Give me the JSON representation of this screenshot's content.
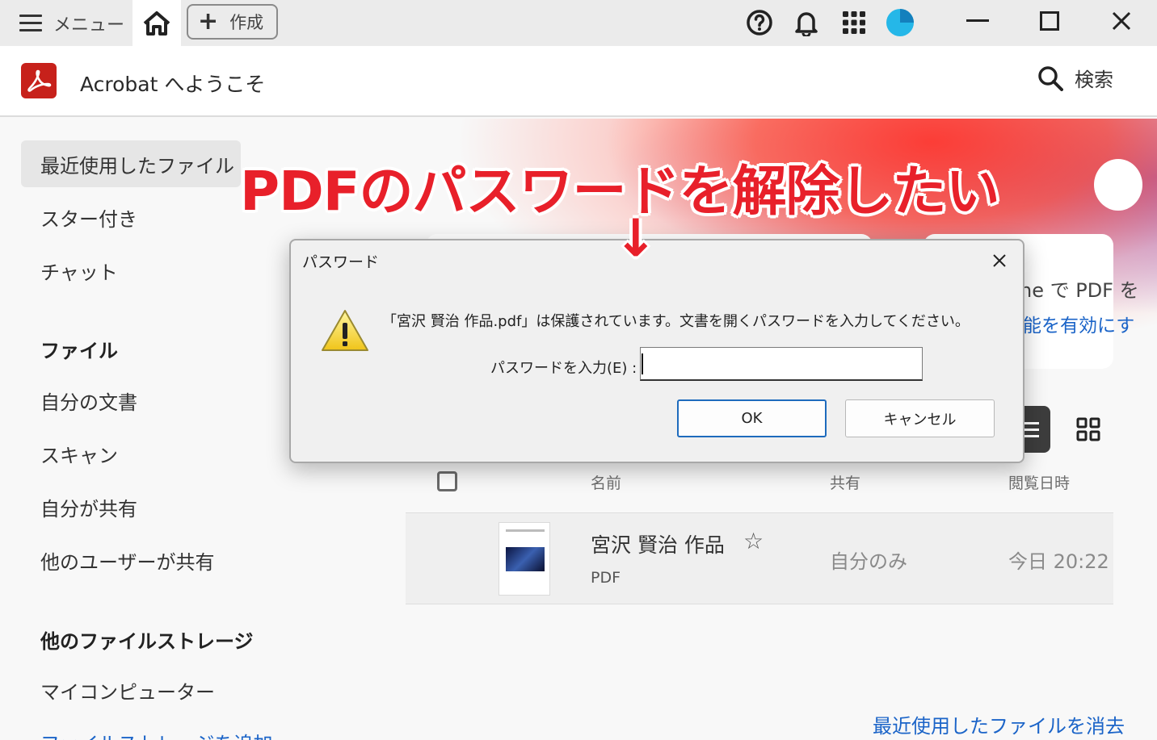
{
  "topbar": {
    "menu_label": "メニュー",
    "create_label": "作成",
    "create_plus": "+"
  },
  "header": {
    "app_title": "Acrobat へようこそ",
    "search_label": "検索"
  },
  "sidebar": {
    "items": [
      {
        "label": "最近使用したファイル",
        "active": true
      },
      {
        "label": "スター付き"
      },
      {
        "label": "チャット"
      }
    ],
    "files_heading": "ファイル",
    "file_items": [
      {
        "label": "自分の文書"
      },
      {
        "label": "スキャン"
      },
      {
        "label": "自分が共有"
      },
      {
        "label": "他のユーザーが共有"
      }
    ],
    "storage_heading": "他のファイルストレージ",
    "storage_items": [
      {
        "label": "マイコンピューター"
      }
    ],
    "add_storage": "ファイルストレージを追加"
  },
  "banner": {
    "card_text": "ne で PDF を",
    "card_link": "能を有効にす"
  },
  "table": {
    "headers": [
      "名前",
      "共有",
      "閲覧日時"
    ],
    "rows": [
      {
        "name": "宮沢 賢治 作品",
        "type": "PDF",
        "shared": "自分のみ",
        "viewed": "今日 20:22"
      }
    ],
    "clear_recent": "最近使用したファイルを消去"
  },
  "annotation": {
    "headline": "PDFのパスワードを解除したい",
    "arrow": "↓",
    "color": "#e8202a"
  },
  "dialog": {
    "title": "パスワード",
    "message": "「宮沢 賢治 作品.pdf」は保護されています。文書を開くパスワードを入力してください。",
    "input_label": "パスワードを入力(E) :",
    "input_value": "",
    "ok_label": "OK",
    "cancel_label": "キャンセル"
  },
  "colors": {
    "brand_red": "#c7211b",
    "link_blue": "#1b64c8",
    "avatar": "#25b7e8"
  },
  "icons": [
    "hamburger-icon",
    "home-icon",
    "help-icon",
    "bell-icon",
    "apps-grid-icon",
    "avatar-icon",
    "minimize-icon",
    "maximize-icon",
    "close-icon",
    "acrobat-logo-icon",
    "search-icon",
    "list-view-icon",
    "grid-view-icon",
    "star-icon",
    "warning-icon"
  ]
}
